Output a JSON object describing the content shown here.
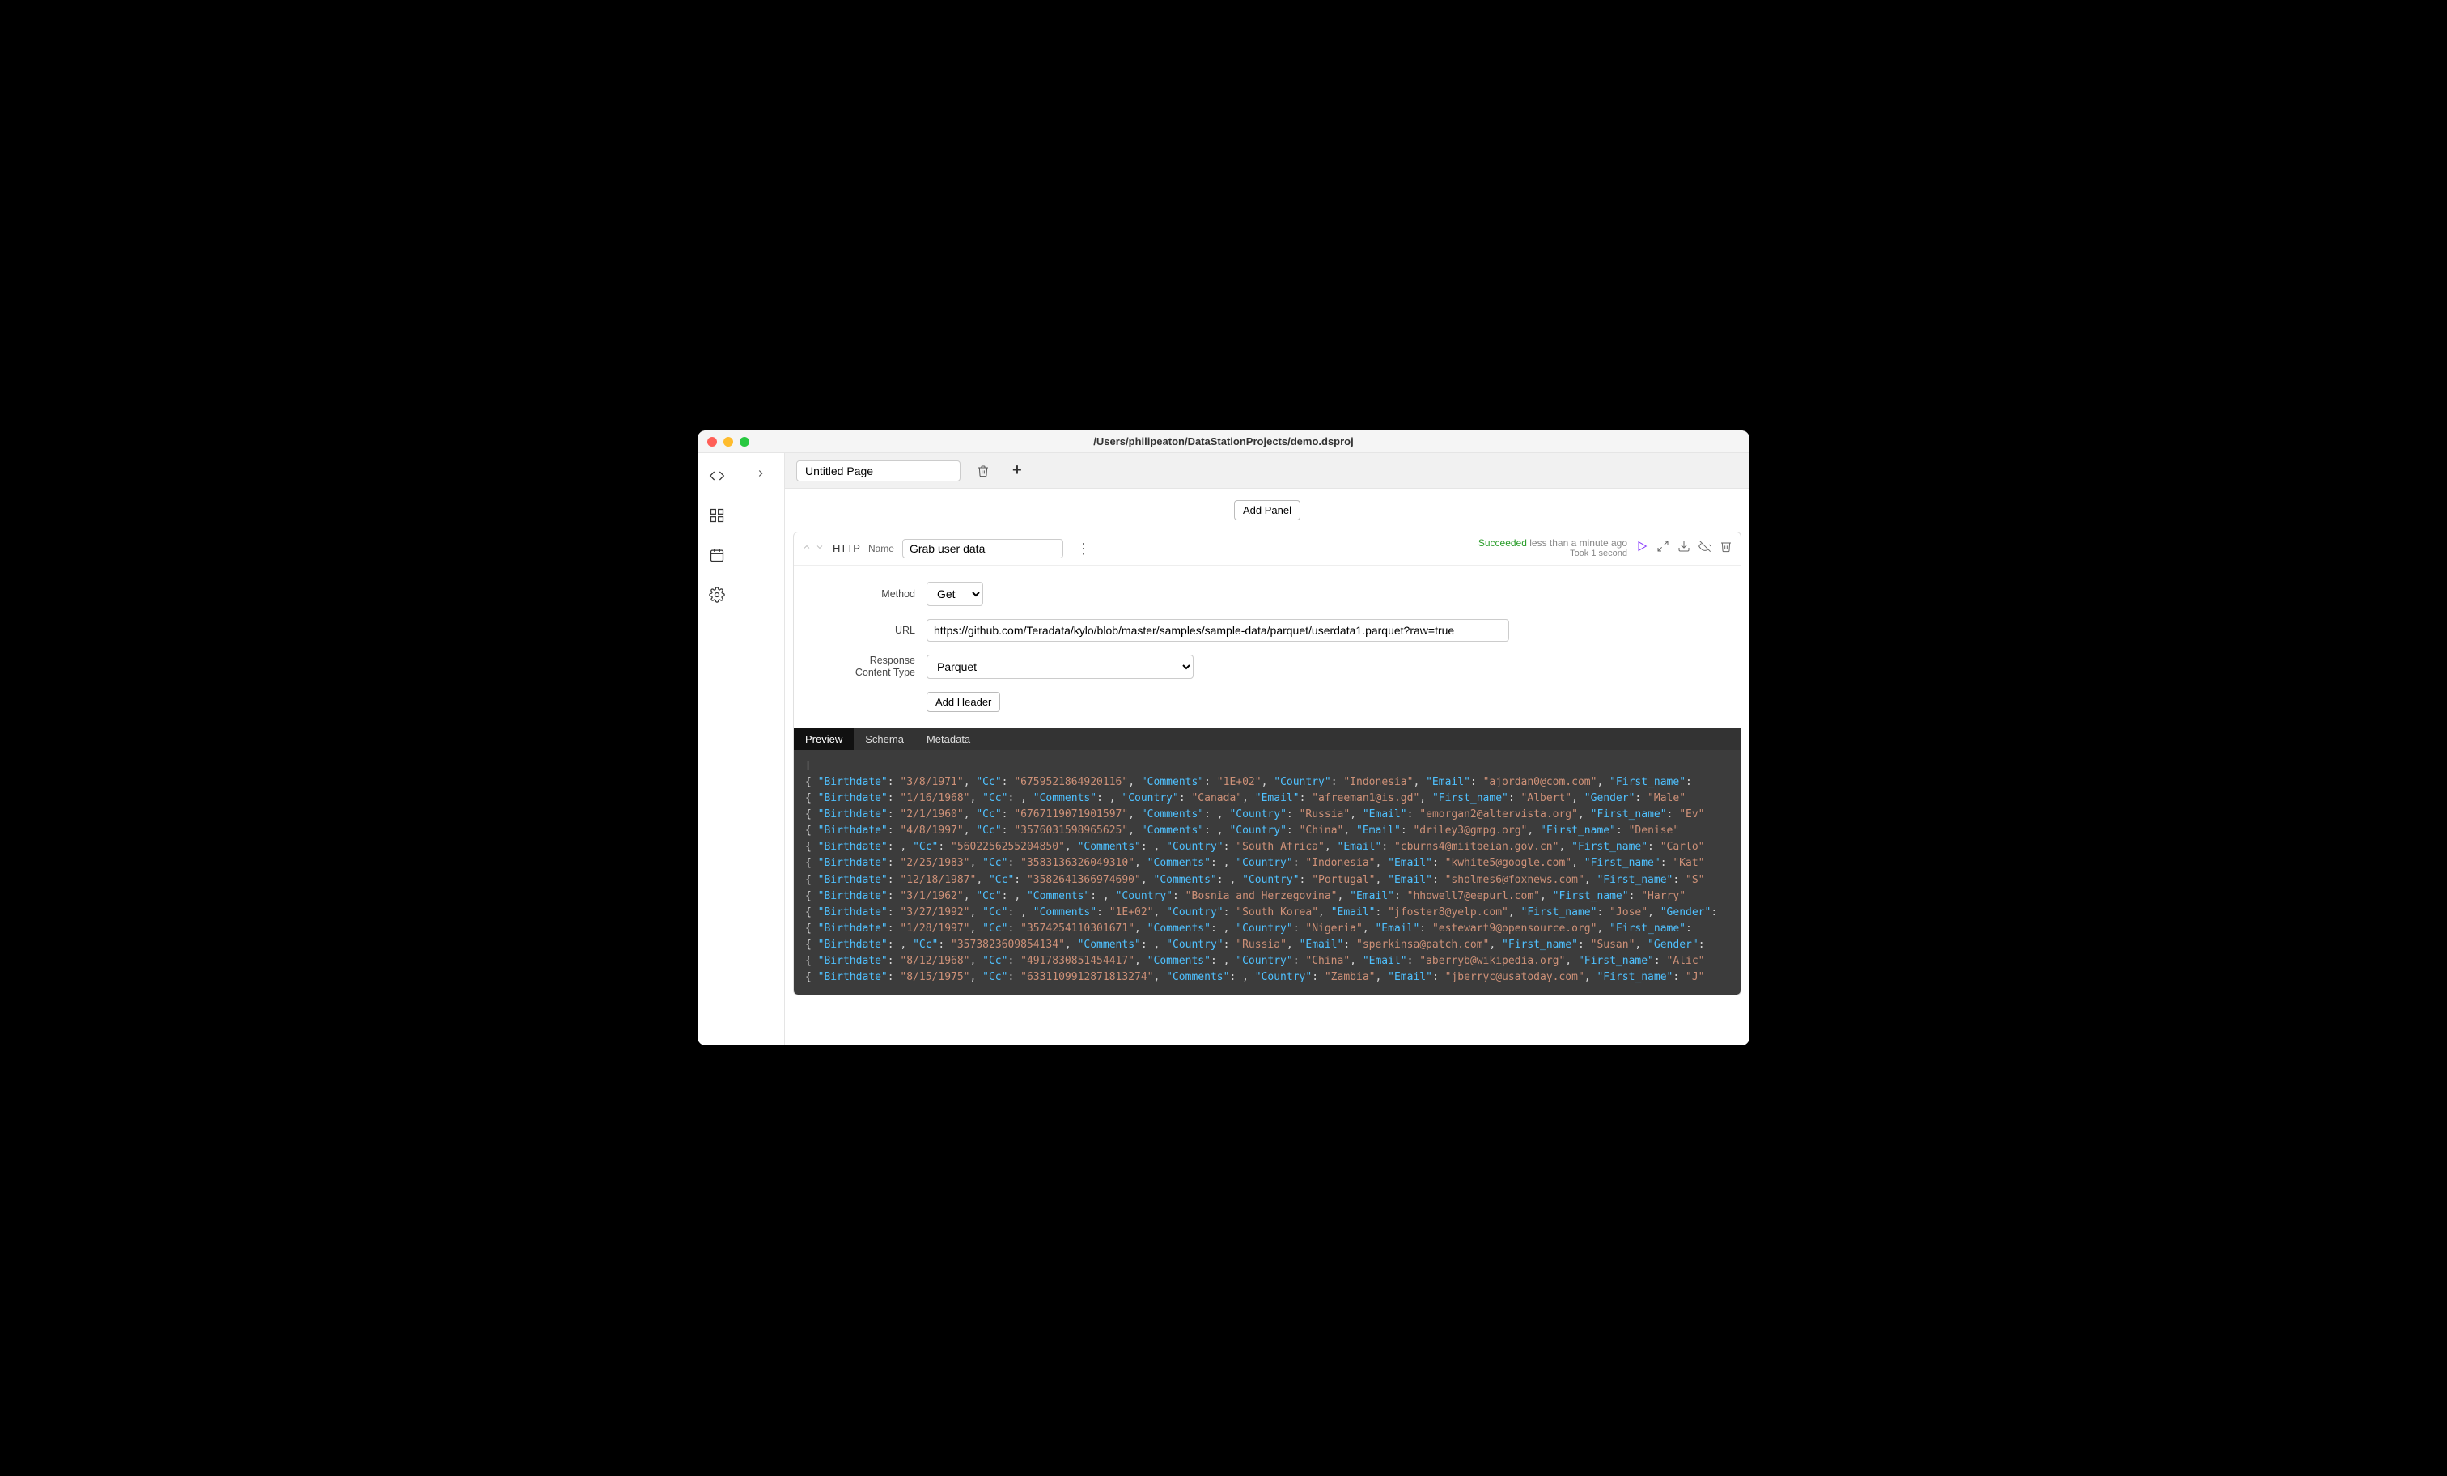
{
  "window": {
    "title": "/Users/philipeaton/DataStationProjects/demo.dsproj"
  },
  "tabs": {
    "page_title": "Untitled Page"
  },
  "buttons": {
    "add_panel": "Add Panel",
    "add_header": "Add Header"
  },
  "panel": {
    "type": "HTTP",
    "name_label": "Name",
    "name_value": "Grab user data",
    "status": {
      "succeeded": "Succeeded",
      "ago": "less than a minute ago",
      "took": "Took 1 second"
    },
    "form": {
      "method_label": "Method",
      "method_value": "Get",
      "url_label": "URL",
      "url_value": "https://github.com/Teradata/kylo/blob/master/samples/sample-data/parquet/userdata1.parquet?raw=true",
      "content_type_label_1": "Response",
      "content_type_label_2": "Content Type",
      "content_type_value": "Parquet"
    },
    "result_tabs": {
      "preview": "Preview",
      "schema": "Schema",
      "metadata": "Metadata"
    }
  },
  "preview_rows": [
    {
      "Birthdate": "3/8/1971",
      "Cc": "6759521864920116",
      "Comments": "1E+02",
      "Country": "Indonesia",
      "Email": "ajordan0@com.com",
      "First_name": ""
    },
    {
      "Birthdate": "1/16/1968",
      "Cc": "",
      "Comments": "",
      "Country": "Canada",
      "Email": "afreeman1@is.gd",
      "First_name": "Albert",
      "Gender": "Male"
    },
    {
      "Birthdate": "2/1/1960",
      "Cc": "6767119071901597",
      "Comments": "",
      "Country": "Russia",
      "Email": "emorgan2@altervista.org",
      "First_name": "Ev"
    },
    {
      "Birthdate": "4/8/1997",
      "Cc": "3576031598965625",
      "Comments": "",
      "Country": "China",
      "Email": "driley3@gmpg.org",
      "First_name": "Denise"
    },
    {
      "Birthdate": "",
      "Cc": "5602256255204850",
      "Comments": "",
      "Country": "South Africa",
      "Email": "cburns4@miitbeian.gov.cn",
      "First_name": "Carlo"
    },
    {
      "Birthdate": "2/25/1983",
      "Cc": "3583136326049310",
      "Comments": "",
      "Country": "Indonesia",
      "Email": "kwhite5@google.com",
      "First_name": "Kat"
    },
    {
      "Birthdate": "12/18/1987",
      "Cc": "3582641366974690",
      "Comments": "",
      "Country": "Portugal",
      "Email": "sholmes6@foxnews.com",
      "First_name": "S"
    },
    {
      "Birthdate": "3/1/1962",
      "Cc": "",
      "Comments": "",
      "Country": "Bosnia and Herzegovina",
      "Email": "hhowell7@eepurl.com",
      "First_name": "Harry"
    },
    {
      "Birthdate": "3/27/1992",
      "Cc": "",
      "Comments": "1E+02",
      "Country": "South Korea",
      "Email": "jfoster8@yelp.com",
      "First_name": "Jose",
      "Gender": ""
    },
    {
      "Birthdate": "1/28/1997",
      "Cc": "3574254110301671",
      "Comments": "",
      "Country": "Nigeria",
      "Email": "estewart9@opensource.org",
      "First_name": ""
    },
    {
      "Birthdate": "",
      "Cc": "3573823609854134",
      "Comments": "",
      "Country": "Russia",
      "Email": "sperkinsa@patch.com",
      "First_name": "Susan",
      "Gender": ""
    },
    {
      "Birthdate": "8/12/1968",
      "Cc": "4917830851454417",
      "Comments": "",
      "Country": "China",
      "Email": "aberryb@wikipedia.org",
      "First_name": "Alic"
    },
    {
      "Birthdate": "8/15/1975",
      "Cc": "6331109912871813274",
      "Comments": "",
      "Country": "Zambia",
      "Email": "jberryc@usatoday.com",
      "First_name": "J"
    }
  ]
}
